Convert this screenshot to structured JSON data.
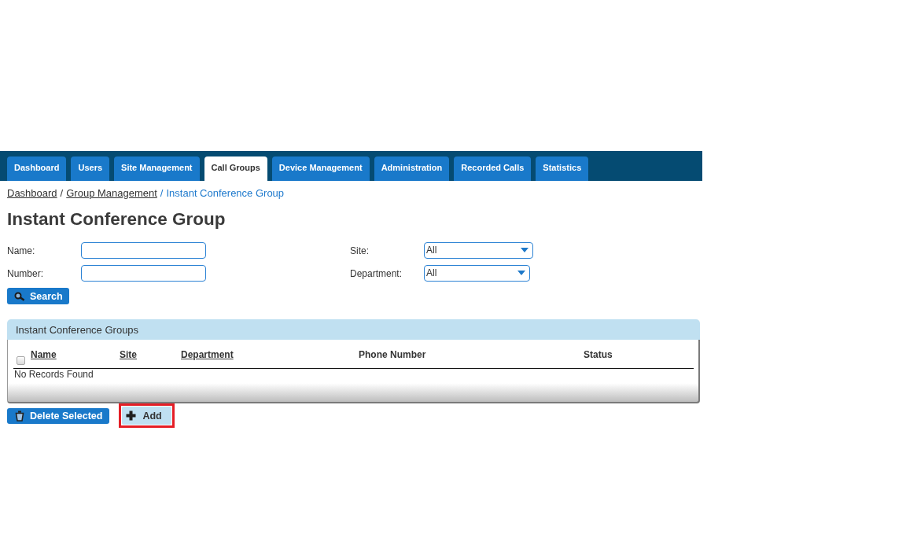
{
  "nav_tabs": [
    {
      "label": "Dashboard",
      "selected": false
    },
    {
      "label": "Users",
      "selected": false
    },
    {
      "label": "Site Management",
      "selected": false
    },
    {
      "label": "Call Groups",
      "selected": true
    },
    {
      "label": "Device Management",
      "selected": false
    },
    {
      "label": "Administration",
      "selected": false
    },
    {
      "label": "Recorded Calls",
      "selected": false
    },
    {
      "label": "Statistics",
      "selected": false
    }
  ],
  "breadcrumb": [
    {
      "label": "Dashboard",
      "kind": "link"
    },
    {
      "label": "/",
      "kind": "separator"
    },
    {
      "label": "Group Management",
      "kind": "link"
    },
    {
      "label": "/",
      "kind": "separator"
    },
    {
      "label": "Instant Conference Group",
      "kind": "current"
    }
  ],
  "page_title": "Instant Conference Group",
  "filters": [
    {
      "label": "Name:",
      "kind": "text"
    },
    {
      "label": "Site:",
      "kind": "select",
      "value": "All"
    },
    {
      "label": "Number:",
      "kind": "text"
    },
    {
      "label": "Department:",
      "kind": "select",
      "value": "All"
    }
  ],
  "search_button": {
    "label": "Search"
  },
  "results_panel": {
    "title": "Instant Conference Groups",
    "select_all": {
      "checked": false
    },
    "columns": [
      {
        "label": "Name",
        "sortable": true
      },
      {
        "label": "Site",
        "sortable": true
      },
      {
        "label": "Department",
        "sortable": true
      },
      {
        "label": "Phone Number",
        "sortable": false
      },
      {
        "label": "Status",
        "sortable": false
      }
    ],
    "empty_message": "No Records Found"
  },
  "actions": [
    {
      "label": "Delete Selected",
      "kind": "delete",
      "highlighted": false
    },
    {
      "label": "Add",
      "kind": "add",
      "highlighted": true
    }
  ]
}
